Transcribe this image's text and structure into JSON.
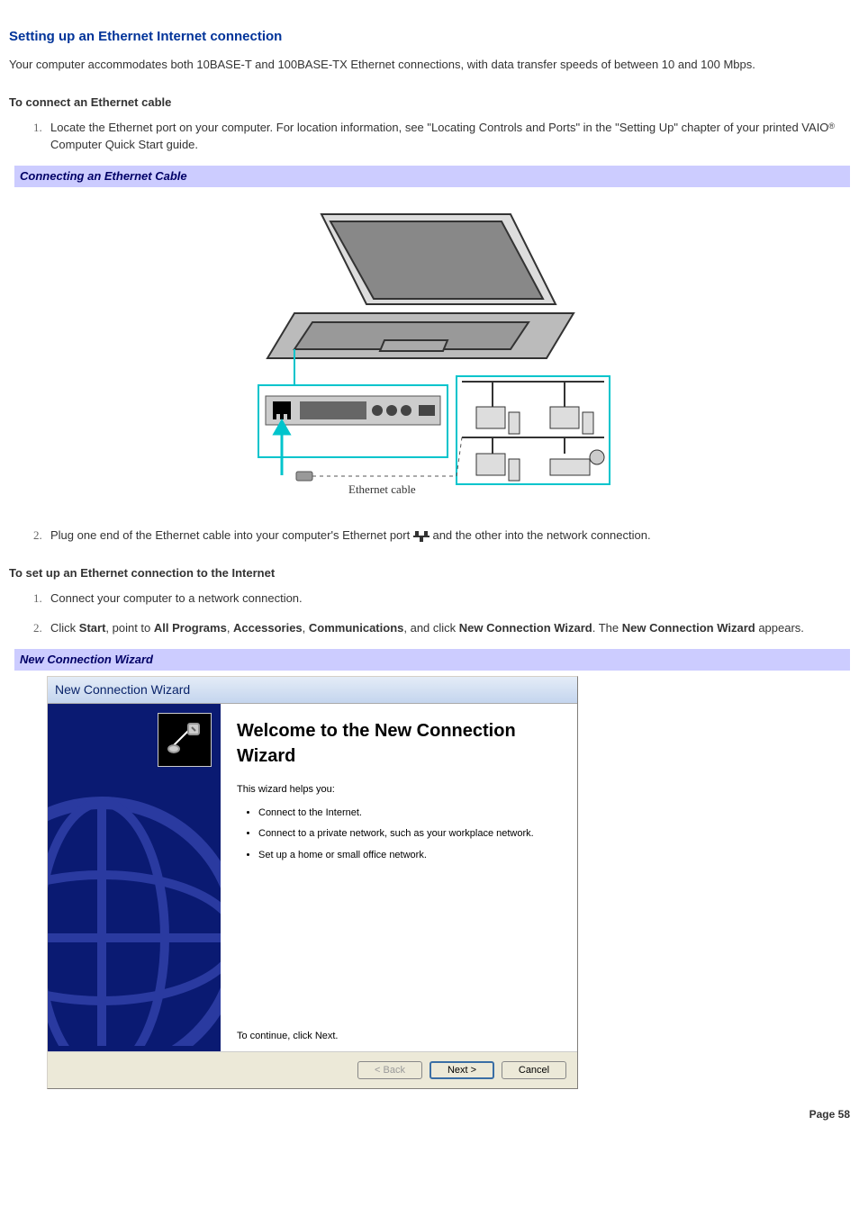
{
  "page_title": "Setting up an Ethernet Internet connection",
  "intro": "Your computer accommodates both 10BASE-T and 100BASE-TX Ethernet connections, with data transfer speeds of between 10 and 100 Mbps.",
  "section_connect_cable": {
    "heading": "To connect an Ethernet cable",
    "step1_pre": "Locate the Ethernet port on your computer. For location information, see \"Locating Controls and Ports\" in the \"Setting Up\" chapter of your printed VAIO",
    "step1_post": " Computer Quick Start guide.",
    "banner": "Connecting an Ethernet Cable",
    "diagram_caption": "Ethernet cable",
    "step2_pre": "Plug one end of the Ethernet cable into your computer's Ethernet port ",
    "step2_post": "and the other into the network connection."
  },
  "section_setup_internet": {
    "heading": "To set up an Ethernet connection to the Internet",
    "step1": "Connect your computer to a network connection.",
    "step2": {
      "t1": "Click ",
      "b1": "Start",
      "t2": ", point to ",
      "b2": "All Programs",
      "t3": ", ",
      "b3": "Accessories",
      "t4": ", ",
      "b4": "Communications",
      "t5": ", and click ",
      "b5": "New Connection Wizard",
      "t6": ". The ",
      "b6": "New Connection Wizard",
      "t7": " appears."
    },
    "banner": "New Connection Wizard"
  },
  "wizard": {
    "title": "New Connection Wizard",
    "heading": "Welcome to the New Connection Wizard",
    "helps_you": "This wizard helps you:",
    "bullets": [
      "Connect to the Internet.",
      "Connect to a private network, such as your workplace network.",
      "Set up a home or small office network."
    ],
    "continue": "To continue, click Next.",
    "buttons": {
      "back": "< Back",
      "next": "Next >",
      "cancel": "Cancel"
    }
  },
  "page_number": "Page 58"
}
